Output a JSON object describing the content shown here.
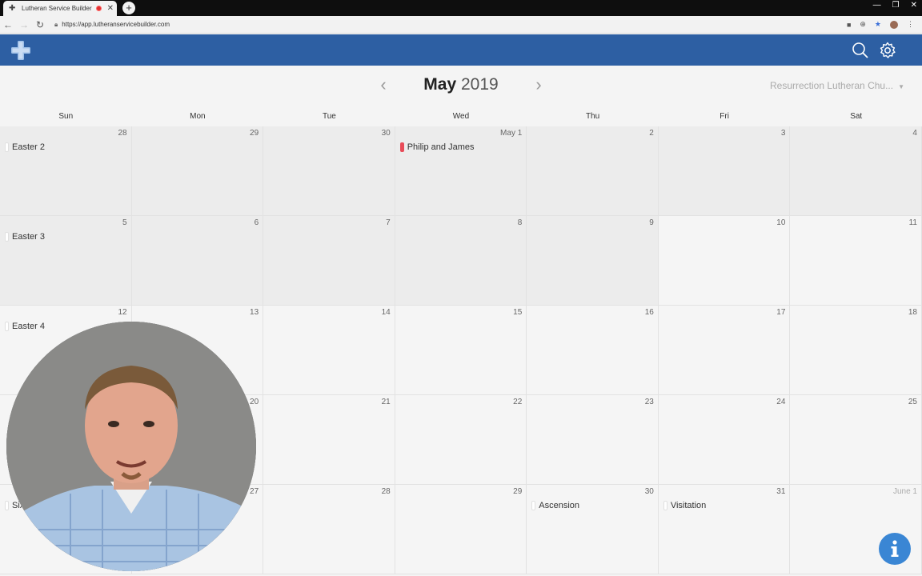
{
  "browser": {
    "tab_title": "Lutheran Service Builder",
    "url": "https://app.lutheranservicebuilder.com"
  },
  "header": {
    "month": "May",
    "year": "2019",
    "church_select": "Resurrection Lutheran Chu..."
  },
  "weekdays": [
    "Sun",
    "Mon",
    "Tue",
    "Wed",
    "Thu",
    "Fri",
    "Sat"
  ],
  "weeks": [
    [
      {
        "day": "28",
        "muted": false,
        "shade": true,
        "event": "Easter 2",
        "red": false
      },
      {
        "day": "29",
        "muted": false,
        "shade": true
      },
      {
        "day": "30",
        "muted": false,
        "shade": true
      },
      {
        "day": "May 1",
        "muted": false,
        "shade": true,
        "event": "Philip and James",
        "red": true
      },
      {
        "day": "2",
        "muted": false,
        "shade": true
      },
      {
        "day": "3",
        "muted": false,
        "shade": true
      },
      {
        "day": "4",
        "muted": false,
        "shade": true
      }
    ],
    [
      {
        "day": "5",
        "shade": true,
        "event": "Easter 3"
      },
      {
        "day": "6",
        "shade": true
      },
      {
        "day": "7",
        "shade": true
      },
      {
        "day": "8",
        "shade": true
      },
      {
        "day": "9",
        "shade": true
      },
      {
        "day": "10"
      },
      {
        "day": "11"
      }
    ],
    [
      {
        "day": "12",
        "event": "Easter 4"
      },
      {
        "day": "13"
      },
      {
        "day": "14"
      },
      {
        "day": "15"
      },
      {
        "day": "16"
      },
      {
        "day": "17"
      },
      {
        "day": "18"
      }
    ],
    [
      {
        "day": ""
      },
      {
        "day": "20"
      },
      {
        "day": "21"
      },
      {
        "day": "22"
      },
      {
        "day": "23"
      },
      {
        "day": "24"
      },
      {
        "day": "25"
      }
    ],
    [
      {
        "day": "",
        "event": "Six"
      },
      {
        "day": "27"
      },
      {
        "day": "28"
      },
      {
        "day": "29"
      },
      {
        "day": "30",
        "event": "Ascension"
      },
      {
        "day": "31",
        "event": "Visitation"
      },
      {
        "day": "June 1",
        "muted": true
      }
    ]
  ],
  "icons": {
    "logo": "cross-logo-icon",
    "search": "search-icon",
    "settings": "gear-icon",
    "info": "info-icon"
  },
  "colors": {
    "header": "#2d5fa3",
    "event_red": "#e84b58",
    "info_button": "#3a86d4"
  }
}
